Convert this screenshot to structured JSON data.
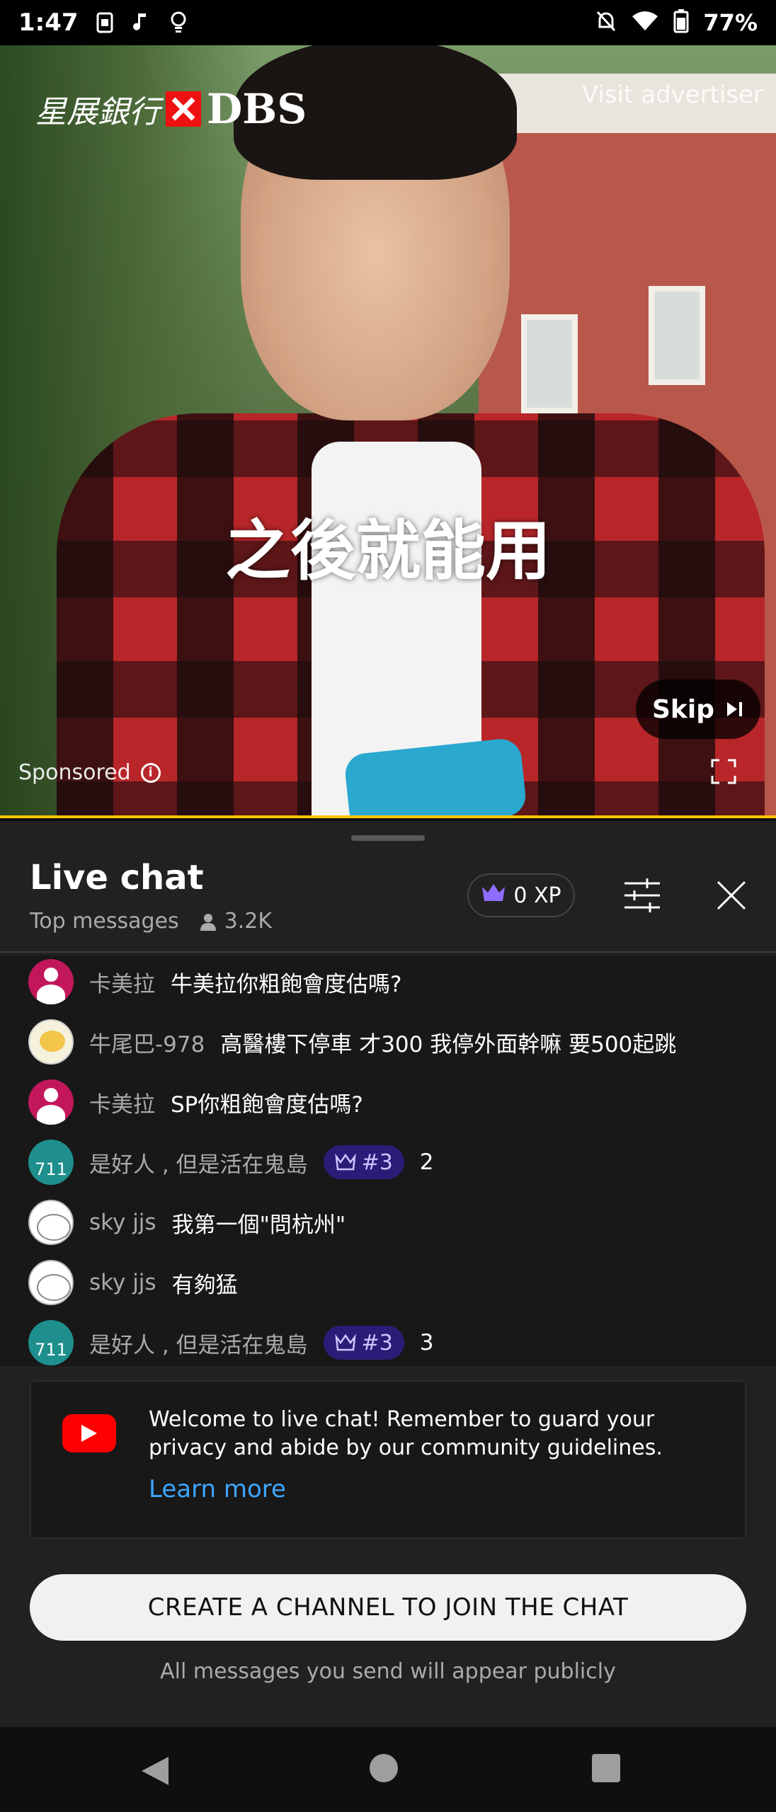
{
  "status_bar": {
    "time": "1:47",
    "battery": "77%"
  },
  "ad": {
    "brand_chinese": "星展銀行",
    "brand_en": "DBS",
    "visit_label": "Visit advertiser",
    "subtitle": "之後就能用",
    "skip_label": "Skip",
    "sponsored_label": "Sponsored",
    "progress_percent": 100
  },
  "chat": {
    "title": "Live chat",
    "mode": "Top messages",
    "viewers": "3.2K",
    "xp": "0 XP",
    "messages": [
      {
        "author": "卡美拉",
        "text": "牛美拉你粗飽會度估嗎?",
        "avatar": "pink"
      },
      {
        "author": "牛尾巴-978",
        "text": "高醫樓下停車 才300 我停外面幹嘛 要500起跳",
        "avatar": "cartoon"
      },
      {
        "author": "卡美拉",
        "text": "SP你粗飽會度估嗎?",
        "avatar": "pink"
      },
      {
        "author": "是好人 , 但是活在鬼島",
        "badge": "#3",
        "text": "2",
        "avatar": "teal",
        "avatar_text": "711"
      },
      {
        "author": "sky jjs",
        "text": "我第一個\"問杭州\"",
        "avatar": "face"
      },
      {
        "author": "sky jjs",
        "text": "有夠猛",
        "avatar": "face"
      },
      {
        "author": "是好人 , 但是活在鬼島",
        "badge": "#3",
        "text": "3",
        "avatar": "teal",
        "avatar_text": "711"
      }
    ],
    "welcome_text": "Welcome to live chat! Remember to guard your privacy and abide by our community guidelines.",
    "learn_more": "Learn more",
    "create_button": "CREATE A CHANNEL TO JOIN THE CHAT",
    "public_note": "All messages you send will appear publicly"
  }
}
